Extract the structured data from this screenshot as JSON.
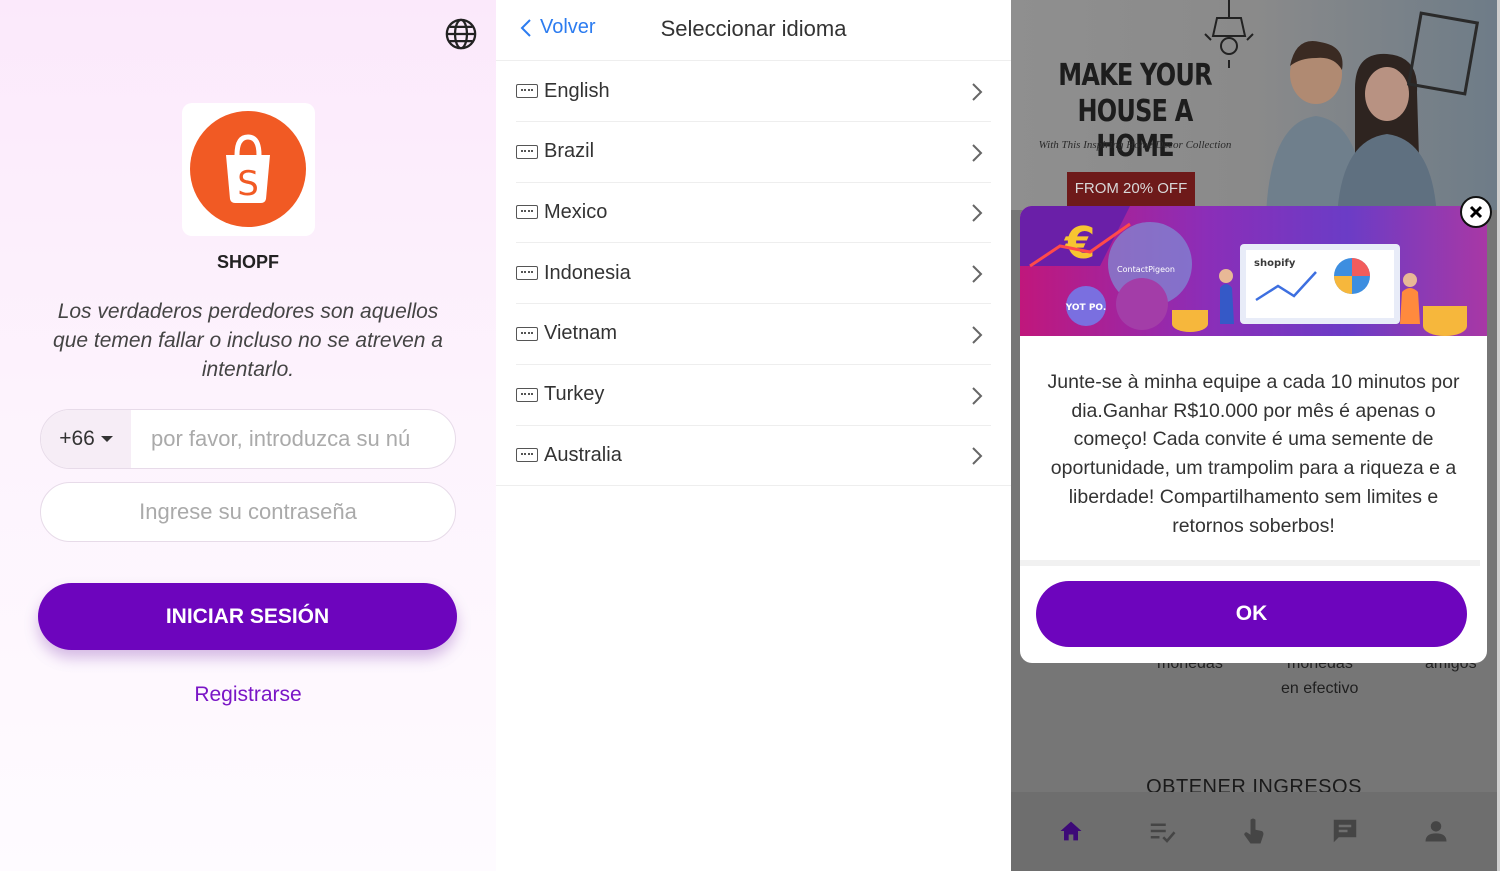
{
  "login": {
    "brand": "SHOPF",
    "quote": "Los verdaderos perdedores son aquellos que temen fallar o incluso no se atreven a intentarlo.",
    "country_code": "+66",
    "phone_placeholder": "por favor, introduzca su nú",
    "password_placeholder": "Ingrese su contraseña",
    "login_label": "INICIAR SESIÓN",
    "register_label": "Registrarse",
    "logo_letter": "S",
    "icons": [
      "globe-icon",
      "shopping-bag-icon",
      "caret-down-icon"
    ]
  },
  "language": {
    "back_label": "Volver",
    "title": "Seleccionar idioma",
    "items": [
      {
        "label": "English"
      },
      {
        "label": "Brazil"
      },
      {
        "label": "Mexico"
      },
      {
        "label": "Indonesia"
      },
      {
        "label": "Vietnam"
      },
      {
        "label": "Turkey"
      },
      {
        "label": "Australia"
      }
    ],
    "icons": [
      "chevron-left-icon",
      "keyboard-icon",
      "chevron-right-icon"
    ]
  },
  "app": {
    "banner": {
      "headline_1": "MAKE YOUR",
      "headline_2": "HOUSE A HOME",
      "subline": "With This Inspiring Home Decor Collection",
      "tag": "FROM 20% OFF"
    },
    "modal": {
      "banner_badge": "shopify",
      "banner_label": "ContactPigeon",
      "banner_logo": "YOT PO.",
      "message": "Junte-se à minha equipe a cada 10 minutos por dia.Ganhar R$10.000 por mês é apenas o começo!  Cada convite é uma semente de oportunidade, um trampolim para a riqueza e a liberdade! Compartilhamento sem limites e retornos soberbos!",
      "ok_label": "OK"
    },
    "background": {
      "label_1": "monedas",
      "label_2": "monedas",
      "label_3": "en efectivo",
      "label_4": "amigos",
      "heading": "OBTENER INGRESOS"
    },
    "tabs": [
      "home-icon",
      "task-list-icon",
      "tap-icon",
      "chat-icon",
      "person-icon"
    ],
    "colors": {
      "primary": "#6d05bd",
      "link": "#2c7cf0",
      "logo_orange": "#f15a24"
    }
  }
}
